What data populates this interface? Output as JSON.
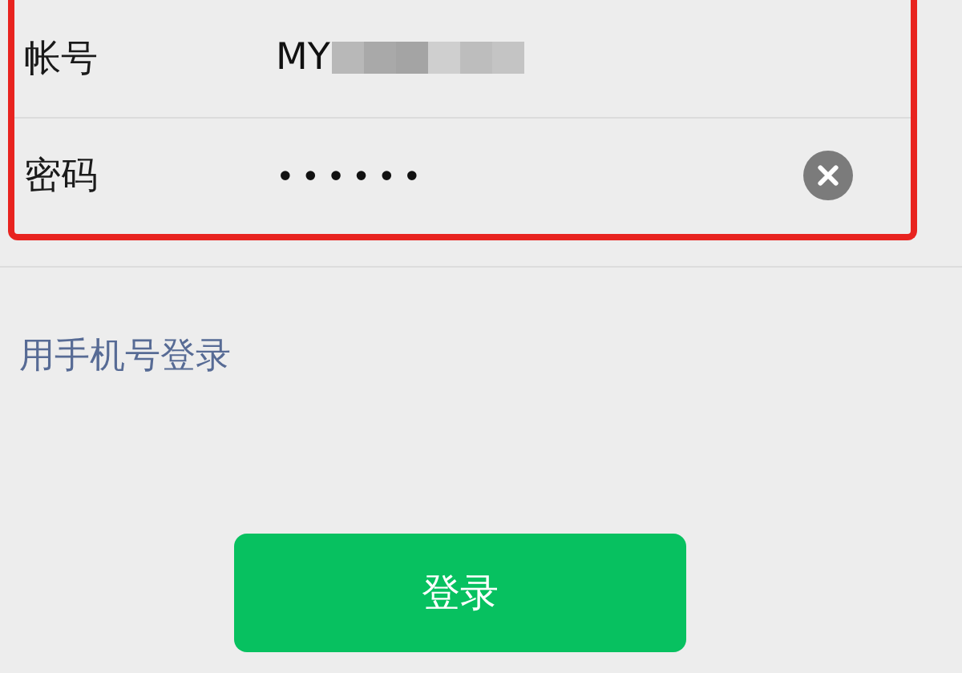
{
  "form": {
    "fields": [
      {
        "kind": "text",
        "label": "帐号",
        "value": "MY",
        "redacted": true,
        "clear_button": false
      },
      {
        "kind": "password",
        "label": "密码",
        "value": "••••••",
        "redacted": false,
        "clear_button": true
      }
    ],
    "highlighted": true
  },
  "phone_login_link": "用手机号登录",
  "login_button": "登录"
}
